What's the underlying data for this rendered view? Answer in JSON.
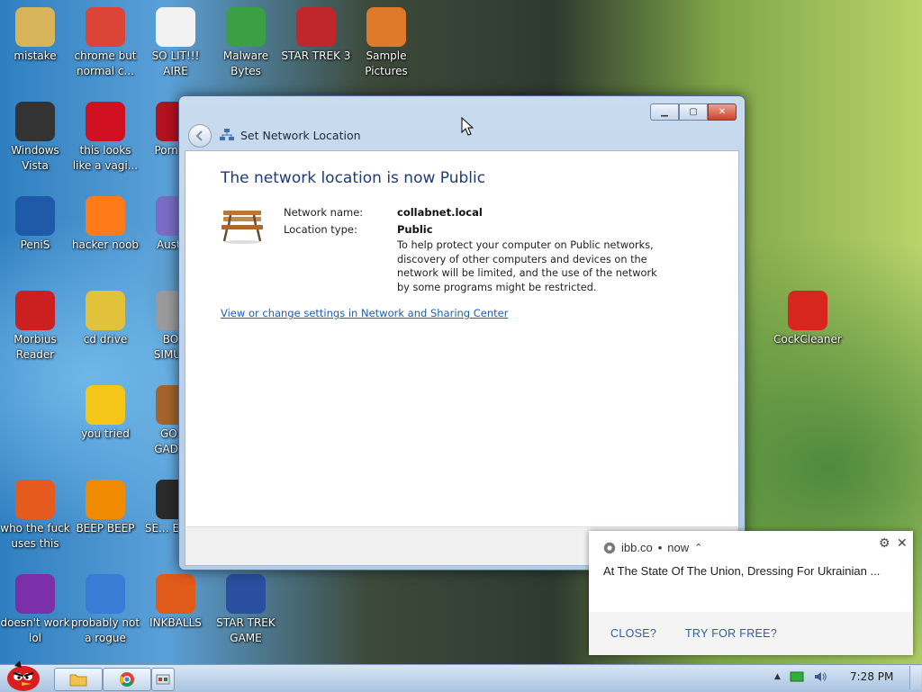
{
  "desktop": {
    "icons": [
      {
        "label": "mistake",
        "icon": "folder-user-icon",
        "color": "#d7b45a"
      },
      {
        "label": "chrome but normal c...",
        "icon": "chrome-icon",
        "color": "#db4437"
      },
      {
        "label": "SO LIT!!! AIRE",
        "icon": "cards-icon",
        "color": "#f2f2f2"
      },
      {
        "label": "Malware Bytes",
        "icon": "shield-check-icon",
        "color": "#3aa043"
      },
      {
        "label": "STAR TREK 3",
        "icon": "star-wars-icon",
        "color": "#c0272d"
      },
      {
        "label": "Sample Pictures",
        "icon": "pictures-folder-icon",
        "color": "#e07a2b"
      },
      {
        "label": "Windows Vista",
        "icon": "trash-bin-icon",
        "color": "#333333"
      },
      {
        "label": "this looks like a vagi...",
        "icon": "opera-icon",
        "color": "#d01020"
      },
      {
        "label": "Porn P...",
        "icon": "acrobat-icon",
        "color": "#b3121f"
      },
      {
        "label": "PeniS",
        "icon": "photoshop-icon",
        "color": "#1e5aa8"
      },
      {
        "label": "hacker noob",
        "icon": "firefox-icon",
        "color": "#ff7b1a"
      },
      {
        "label": "Austr...",
        "icon": "spider-solitaire-icon",
        "color": "#7a6cc4"
      },
      {
        "label": "Morbius Reader",
        "icon": "pdf-reader-icon",
        "color": "#cc1f1f"
      },
      {
        "label": "cd drive",
        "icon": "cd-drive-icon",
        "color": "#e1c23a"
      },
      {
        "label": "BOSI SIMUL...",
        "icon": "explosion-icon",
        "color": "#9a9a9a"
      },
      {
        "label": "you tried",
        "icon": "star-icon",
        "color": "#f5c518"
      },
      {
        "label": "GO ... GADG...",
        "icon": "briefcase-icon",
        "color": "#a4632a"
      },
      {
        "label": "who the fuck uses this",
        "icon": "lightning-icon",
        "color": "#e55a1f"
      },
      {
        "label": "BEEP BEEP",
        "icon": "vlc-cone-icon",
        "color": "#f08a00"
      },
      {
        "label": "SE... EDIT...",
        "icon": "hex-editor-icon",
        "color": "#2b2b2b"
      },
      {
        "label": "doesn't work lol",
        "icon": "yahoo-messenger-icon",
        "color": "#7b2fa8"
      },
      {
        "label": "probably not a rogue",
        "icon": "gears-monitor-icon",
        "color": "#3a7bd5"
      },
      {
        "label": "INKBALLS",
        "icon": "inkball-icon",
        "color": "#e05a1a"
      },
      {
        "label": "STAR TREK GAME",
        "icon": "star-trek-icon",
        "color": "#2a4fa0"
      },
      {
        "label": "CockCleaner",
        "icon": "ccleaner-icon",
        "color": "#d7261e"
      }
    ]
  },
  "window": {
    "title": "Set Network Location",
    "heading": "The network location is now Public",
    "network_name_label": "Network name:",
    "network_name_value": "collabnet.local",
    "location_type_label": "Location type:",
    "location_type_value": "Public",
    "description": "To help protect your computer on Public networks, discovery of other computers and devices on the network will be limited, and the use of the network by some programs might be restricted.",
    "link": "View or change settings in Network and Sharing Center",
    "minimize_glyph": "▁",
    "maximize_glyph": "▢",
    "close_glyph": "✕"
  },
  "notification": {
    "source": "ibb.co",
    "separator": "•",
    "time": "now",
    "chevron": "⌃",
    "message": "At The State Of The Union, Dressing For Ukrainian ...",
    "close_action": "CLOSE?",
    "try_action": "TRY FOR FREE?",
    "settings_glyph": "⚙",
    "dismiss_glyph": "✕"
  },
  "taskbar": {
    "clock": "7:28 PM",
    "tray_arrow": "▲"
  }
}
